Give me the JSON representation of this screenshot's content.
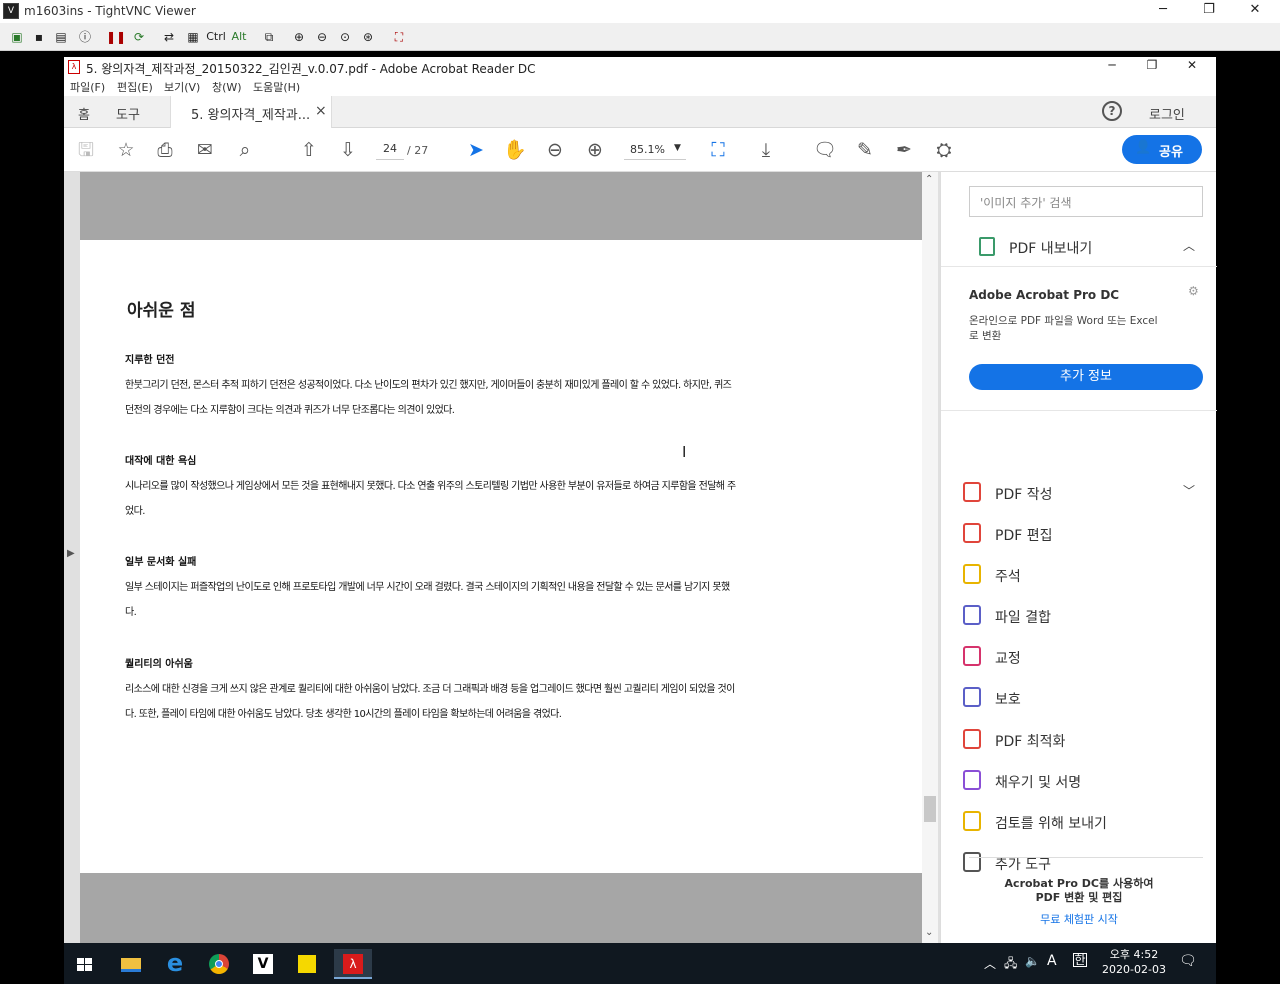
{
  "vnc": {
    "title": "m1603ins - TightVNC Viewer",
    "toolbar_labels": {
      "ctrl": "Ctrl",
      "alt": "Alt"
    }
  },
  "acrobat": {
    "title": "5. 왕의자격_제작과정_20150322_김인권_v.0.07.pdf - Adobe Acrobat Reader DC",
    "menu": [
      "파일(F)",
      "편집(E)",
      "보기(V)",
      "창(W)",
      "도움말(H)"
    ],
    "tabs": {
      "home": "홈",
      "tools": "도구",
      "doc": "5. 왕의자격_제작과...",
      "close": "×"
    },
    "login": "로그인",
    "page_current": "24",
    "page_total": "/  27",
    "zoom": "85.1%",
    "share": "공유"
  },
  "document": {
    "heading": "아쉬운 점",
    "sections": [
      {
        "title": "지루한 던전",
        "line1": "한붓그리기 던전, 몬스터 추적 피하기 던전은 성공적이었다. 다소 난이도의 편차가 있긴 했지만, 게이머들이 충분히 재미있게 플레이 할 수 있었다. 하지만, 퀴즈",
        "line2": "던전의 경우에는 다소 지루함이 크다는 의견과 퀴즈가 너무 단조롭다는 의견이 있었다."
      },
      {
        "title": "대작에 대한 욕심",
        "line1": "시나리오를 많이 작성했으나 게임상에서 모든 것을 표현해내지 못했다. 다소 연출 위주의 스토리텔링 기법만 사용한 부분이 유저들로 하여금 지루함을 전달해 주",
        "line2": "었다."
      },
      {
        "title": "일부 문서화 실패",
        "line1": "일부 스테이지는 퍼즐작업의 난이도로 인해 프로토타입 개발에 너무 시간이 오래 걸렸다. 결국  스테이지의 기획적인 내용을 전달할 수 있는 문서를 남기지 못했",
        "line2": "다."
      },
      {
        "title": "퀄리티의 아쉬움",
        "line1": "리소스에 대한 신경을 크게 쓰지 않은 관계로 퀄리티에 대한 아쉬움이 남았다. 조금 더 그래픽과 배경 등을 업그레이드 했다면 훨씬 고퀄리티 게임이 되었을 것이",
        "line2": "다. 또한, 플레이 타임에 대한 아쉬움도 남았다. 당초 생각한 10시간의 플레이 타임을 확보하는데 어려움을 겪었다."
      }
    ]
  },
  "right_pane": {
    "search_placeholder": "'이미지 추가' 검색",
    "export_label": "PDF 내보내기",
    "promo_title": "Adobe Acrobat Pro DC",
    "promo_desc1": "온라인으로 PDF 파일을 Word 또는 Excel",
    "promo_desc2": "로 변환",
    "more_info": "추가 정보",
    "tools": [
      {
        "label": "PDF 작성",
        "icon": "create-pdf-icon",
        "color": "#e0453b"
      },
      {
        "label": "PDF 편집",
        "icon": "edit-pdf-icon",
        "color": "#e0453b"
      },
      {
        "label": "주석",
        "icon": "comment-icon",
        "color": "#e8b400"
      },
      {
        "label": "파일 결합",
        "icon": "combine-files-icon",
        "color": "#5b5fc7"
      },
      {
        "label": "교정",
        "icon": "redact-icon",
        "color": "#d6336c"
      },
      {
        "label": "보호",
        "icon": "protect-icon",
        "color": "#5b5fc7"
      },
      {
        "label": "PDF 최적화",
        "icon": "optimize-pdf-icon",
        "color": "#e0453b"
      },
      {
        "label": "채우기 및 서명",
        "icon": "fill-sign-icon",
        "color": "#8a4fd6"
      },
      {
        "label": "검토를 위해 보내기",
        "icon": "send-review-icon",
        "color": "#e8b400"
      },
      {
        "label": "추가 도구",
        "icon": "more-tools-icon",
        "color": "#555555"
      }
    ],
    "footer1": "Acrobat Pro DC를 사용하여",
    "footer2": "PDF 변환 및 편집",
    "trial": "무료 체험판 시작"
  },
  "taskbar": {
    "ampm_time": "오후 4:52",
    "date": "2020-02-03",
    "ime": "A"
  },
  "colors": {
    "accent": "#1473e6",
    "page_gray": "#a6a6a6"
  }
}
